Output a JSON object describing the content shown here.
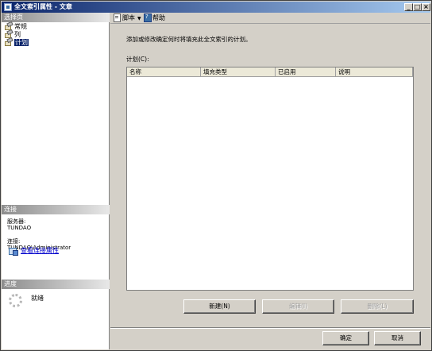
{
  "window": {
    "title": "全文索引属性 - 文章",
    "minimize": "_",
    "maximize": "□",
    "close": "×"
  },
  "sidebar": {
    "select_page_header": "选择页",
    "pages": [
      {
        "label": "常规",
        "selected": false
      },
      {
        "label": "列",
        "selected": false
      },
      {
        "label": "计划",
        "selected": true
      }
    ],
    "connection_header": "连接",
    "server_label": "服务器:",
    "server_value": "TUNDAO",
    "connection_label": "连接:",
    "connection_value": "TUNDAO\\Administrator",
    "view_connection_link": "查看连接属性",
    "progress_header": "进度",
    "progress_status": "就绪"
  },
  "toolbar": {
    "script_label": "脚本",
    "help_label": "帮助"
  },
  "main": {
    "description": "添加或修改确定何时将填充此全文索引的计划。",
    "plan_label": "计划(C):",
    "columns": [
      "名称",
      "填充类型",
      "已启用",
      "说明"
    ],
    "rows": []
  },
  "buttons": {
    "new": "新建(N)",
    "edit": "编辑(I)",
    "delete": "删除(L)",
    "ok": "确定",
    "cancel": "取消"
  },
  "colors": {
    "title_bar_start": "#0a246a",
    "title_bar_end": "#a6caf0",
    "selection": "#0a246a",
    "link": "#0000cc",
    "dialog_bg": "#d4d0c8"
  }
}
